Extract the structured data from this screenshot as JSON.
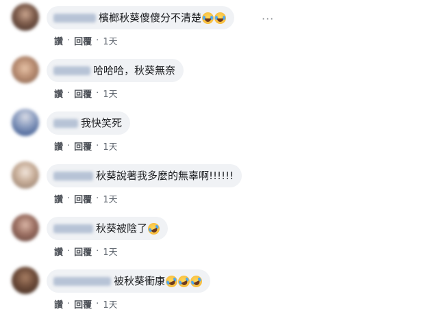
{
  "comments": [
    {
      "text": "檳榔秋葵傻傻分不清楚",
      "emojis": [
        "laugh-cry",
        "laugh-cry"
      ],
      "like": "讚",
      "reply": "回覆",
      "time": "1天",
      "more": "···"
    },
    {
      "text": "哈哈哈，秋葵無奈",
      "emojis": [],
      "like": "讚",
      "reply": "回覆",
      "time": "1天"
    },
    {
      "text": "我快笑死",
      "emojis": [],
      "like": "讚",
      "reply": "回覆",
      "time": "1天"
    },
    {
      "text": "秋葵說著我多麼的無辜啊!!!!!!",
      "emojis": [],
      "like": "讚",
      "reply": "回覆",
      "time": "1天"
    },
    {
      "text": "秋葵被陰了",
      "emojis": [
        "rofl"
      ],
      "like": "讚",
      "reply": "回覆",
      "time": "1天"
    },
    {
      "text": "被秋葵衝康",
      "emojis": [
        "rofl",
        "rofl",
        "rofl"
      ],
      "like": "讚",
      "reply": "回覆",
      "time": "1天"
    }
  ],
  "separator": "·",
  "colors": {
    "bubble": "#f0f2f5",
    "text": "#1c1e21",
    "action": "#4b4f56",
    "name_blur": "#b7c3d6"
  }
}
